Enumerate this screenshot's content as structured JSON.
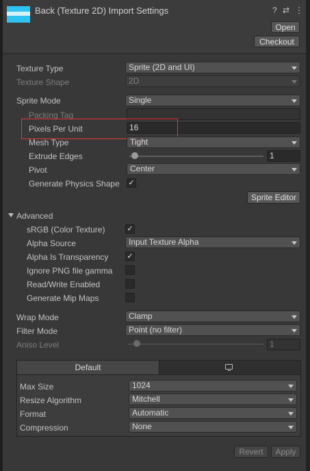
{
  "header": {
    "title": "Back (Texture 2D) Import Settings",
    "help_icon": "?",
    "presets_icon": "⇄",
    "menu_icon": "⋮",
    "open_label": "Open",
    "checkout_label": "Checkout"
  },
  "texture": {
    "type_label": "Texture Type",
    "type_value": "Sprite (2D and UI)",
    "shape_label": "Texture Shape",
    "shape_value": "2D"
  },
  "sprite": {
    "mode_label": "Sprite Mode",
    "mode_value": "Single",
    "packing_tag_label": "Packing Tag",
    "packing_tag_value": "",
    "ppu_label": "Pixels Per Unit",
    "ppu_value": "16",
    "mesh_type_label": "Mesh Type",
    "mesh_type_value": "Tight",
    "extrude_label": "Extrude Edges",
    "extrude_value": "1",
    "pivot_label": "Pivot",
    "pivot_value": "Center",
    "physics_label": "Generate Physics Shape",
    "physics_checked": true,
    "editor_button": "Sprite Editor"
  },
  "advanced": {
    "header": "Advanced",
    "srgb_label": "sRGB (Color Texture)",
    "srgb_checked": true,
    "alpha_source_label": "Alpha Source",
    "alpha_source_value": "Input Texture Alpha",
    "alpha_transparency_label": "Alpha Is Transparency",
    "alpha_transparency_checked": true,
    "ignore_gamma_label": "Ignore PNG file gamma",
    "ignore_gamma_checked": false,
    "read_write_label": "Read/Write Enabled",
    "read_write_checked": false,
    "mipmaps_label": "Generate Mip Maps",
    "mipmaps_checked": false
  },
  "sampling": {
    "wrap_label": "Wrap Mode",
    "wrap_value": "Clamp",
    "filter_label": "Filter Mode",
    "filter_value": "Point (no filter)",
    "aniso_label": "Aniso Level",
    "aniso_value": "1"
  },
  "platform": {
    "tab_default": "Default",
    "tab_pc_icon": "monitor-icon",
    "max_size_label": "Max Size",
    "max_size_value": "1024",
    "resize_label": "Resize Algorithm",
    "resize_value": "Mitchell",
    "format_label": "Format",
    "format_value": "Automatic",
    "compression_label": "Compression",
    "compression_value": "None"
  },
  "footer": {
    "revert_label": "Revert",
    "apply_label": "Apply"
  },
  "colors": {
    "background": "#383838",
    "highlight_box": "#e53935",
    "thumbnail": "#2ec4f0"
  }
}
